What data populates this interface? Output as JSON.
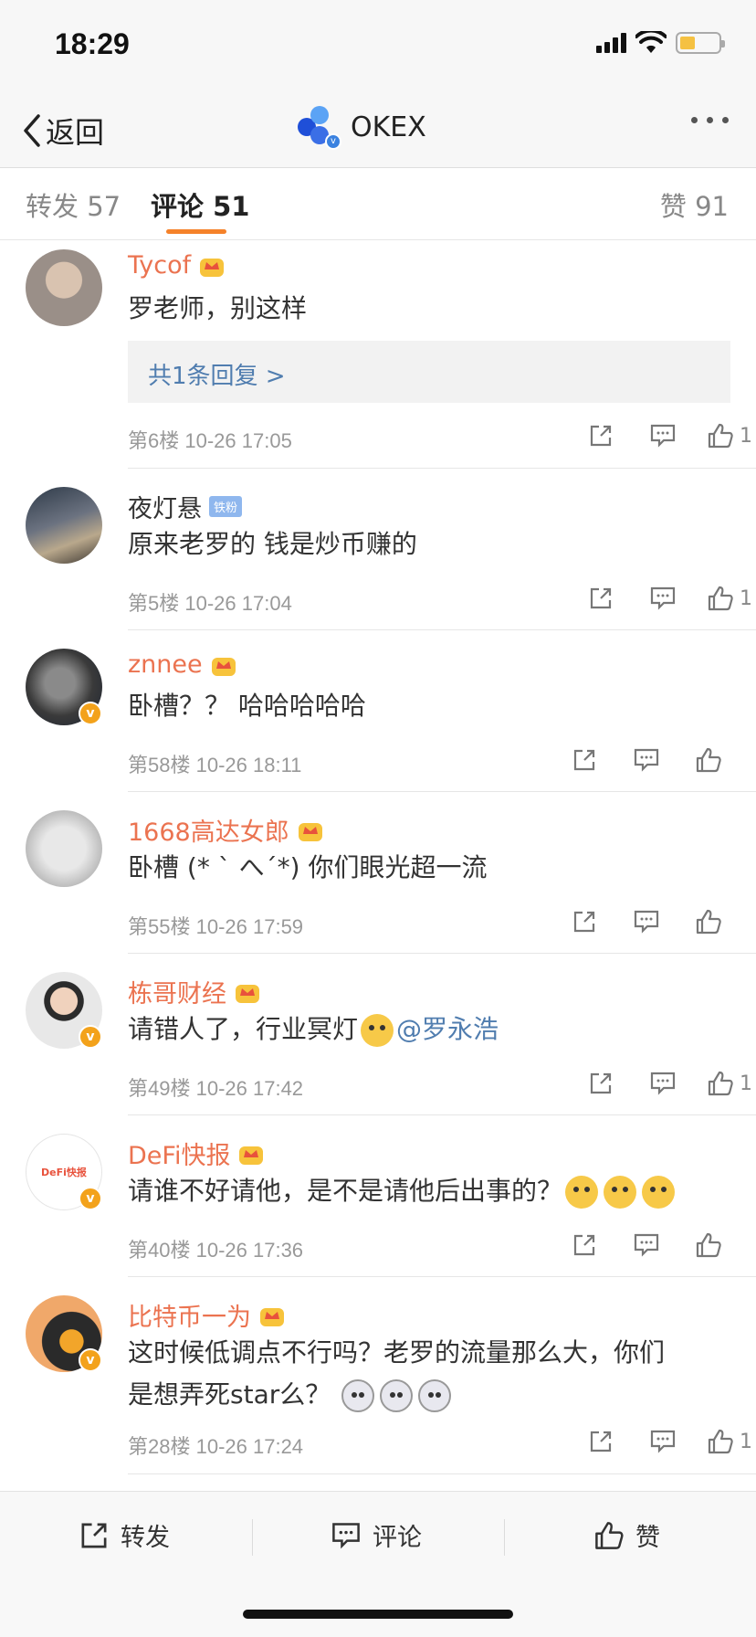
{
  "status_bar": {
    "time": "18:29"
  },
  "nav": {
    "back_label": "返回",
    "title": "OKEX"
  },
  "tabs": [
    {
      "label": "转发",
      "count": "57"
    },
    {
      "label": "评论",
      "count": "51"
    },
    {
      "label": "赞",
      "count": "91"
    }
  ],
  "comments": [
    {
      "name": "Tycof",
      "text": "罗老师，别这样",
      "reply": "共1条回复 >",
      "floor": "第6楼",
      "time": "10-26 17:05",
      "likes": "1"
    },
    {
      "name": "夜灯悬",
      "badge": "铁粉",
      "text": "原来老罗的 钱是炒币赚的",
      "floor": "第5楼",
      "time": "10-26 17:04",
      "likes": "1"
    },
    {
      "name": "znnee",
      "text": "卧槽？？ 哈哈哈哈哈",
      "floor": "第58楼",
      "time": "10-26 18:11",
      "likes": ""
    },
    {
      "name": "1668高达女郎",
      "text": "卧槽 (* ` へ´*) 你们眼光超一流",
      "floor": "第55楼",
      "time": "10-26 17:59",
      "likes": ""
    },
    {
      "name": "栋哥财经",
      "text": "请错人了，行业冥灯",
      "mention": "@罗永浩",
      "floor": "第49楼",
      "time": "10-26 17:42",
      "likes": "1"
    },
    {
      "name": "DeFi快报",
      "text": "请谁不好请他，是不是请他后出事的？",
      "floor": "第40楼",
      "time": "10-26 17:36",
      "likes": ""
    },
    {
      "name": "比特币一为",
      "text_line1": "这时候低调点不行吗？老罗的流量那么大，你们",
      "text_line2": "是想弄死star么？",
      "floor": "第28楼",
      "time": "10-26 17:24",
      "likes": "1"
    }
  ],
  "avatar_labels": {
    "defi": "DeFi快报"
  },
  "bottom_bar": {
    "repost": "转发",
    "comment": "评论",
    "like": "赞"
  },
  "colors": {
    "name_orange": "#eb7350",
    "accent": "#f5822a",
    "link": "#507daf"
  }
}
